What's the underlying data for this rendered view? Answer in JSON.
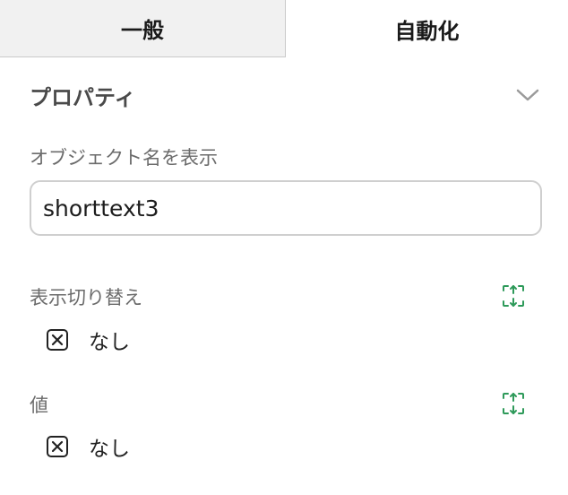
{
  "tabs": {
    "general": "一般",
    "automation": "自動化"
  },
  "properties": {
    "title": "プロパティ",
    "display_name_label": "オブジェクト名を表示",
    "display_name_value": "shorttext3",
    "toggle_label": "表示切り替え",
    "toggle_value": "なし",
    "value_label": "値",
    "value_value": "なし"
  },
  "colors": {
    "accent_green": "#2e9a5a"
  }
}
